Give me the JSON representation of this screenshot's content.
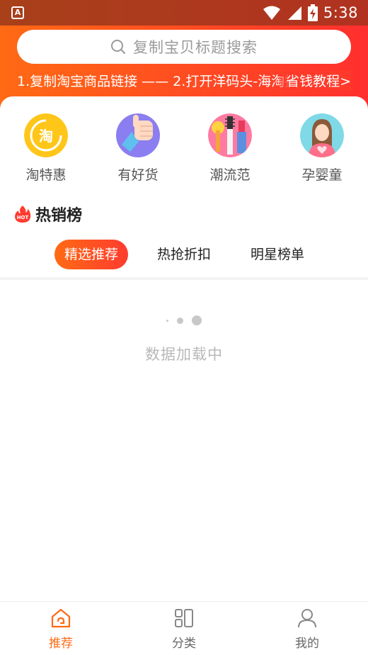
{
  "status_bar": {
    "app_icon": "A",
    "time": "5:38",
    "icons": [
      "wifi-icon",
      "signal-icon",
      "battery-charging-icon"
    ]
  },
  "search": {
    "placeholder": "复制宝贝标题搜索",
    "icon": "search-icon"
  },
  "tip": {
    "text": "1.复制淘宝商品链接 —— 2.打开洋码头-海淘搜",
    "link": "省钱教程>"
  },
  "categories": [
    {
      "label": "淘特惠",
      "icon": "taobao-coin-icon",
      "color": "#ffc61a"
    },
    {
      "label": "有好货",
      "icon": "thumbs-up-icon",
      "color": "#8b7ef0"
    },
    {
      "label": "潮流范",
      "icon": "cosmetics-icon",
      "color": "#ff7aa0"
    },
    {
      "label": "孕婴童",
      "icon": "mother-baby-icon",
      "color": "#7fd9e6"
    }
  ],
  "hot": {
    "badge": "HOT",
    "title": "热销榜"
  },
  "tabs": [
    {
      "label": "精选推荐",
      "active": true
    },
    {
      "label": "热抢折扣",
      "active": false
    },
    {
      "label": "明星榜单",
      "active": false
    }
  ],
  "loading": {
    "text": "数据加载中"
  },
  "bottom_nav": [
    {
      "label": "推荐",
      "icon": "home-icon",
      "active": true
    },
    {
      "label": "分类",
      "icon": "category-grid-icon",
      "active": false
    },
    {
      "label": "我的",
      "icon": "user-icon",
      "active": false
    }
  ],
  "colors": {
    "accent": "#ff6a14",
    "accent_end": "#ff3b2f",
    "muted_text": "#b8b8b8"
  }
}
